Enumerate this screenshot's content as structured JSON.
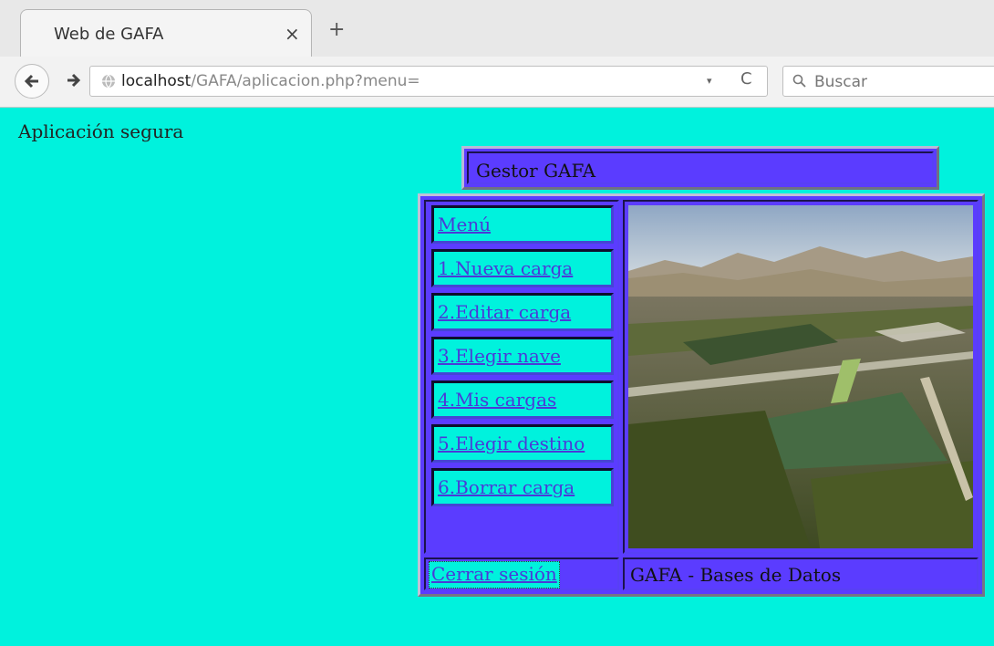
{
  "browser": {
    "tab_title": "Web de GAFA",
    "tab_close": "×",
    "new_tab": "+",
    "url_host": "localhost",
    "url_path": "/GAFA/aplicacion.php?menu=",
    "url_dropdown": "▾",
    "url_reload": "C",
    "search_placeholder": "Buscar"
  },
  "page": {
    "heading": "Aplicación segura",
    "header_title": "Gestor GAFA",
    "menu": [
      {
        "label": "Menú"
      },
      {
        "label": "1.Nueva carga"
      },
      {
        "label": "2.Editar carga"
      },
      {
        "label": "3.Elegir nave"
      },
      {
        "label": "4.Mis cargas"
      },
      {
        "label": "5.Elegir destino"
      },
      {
        "label": "6.Borrar carga"
      }
    ],
    "logout_label": "Cerrar sesión",
    "footer": "GAFA - Bases de Datos"
  },
  "colors": {
    "page_bg": "#00f2dd",
    "panel": "#5b3cff",
    "link": "#4a3ad8"
  },
  "icons": {
    "back": "back-arrow-icon",
    "forward": "forward-arrow-icon",
    "globe": "globe-icon",
    "search": "search-icon"
  }
}
